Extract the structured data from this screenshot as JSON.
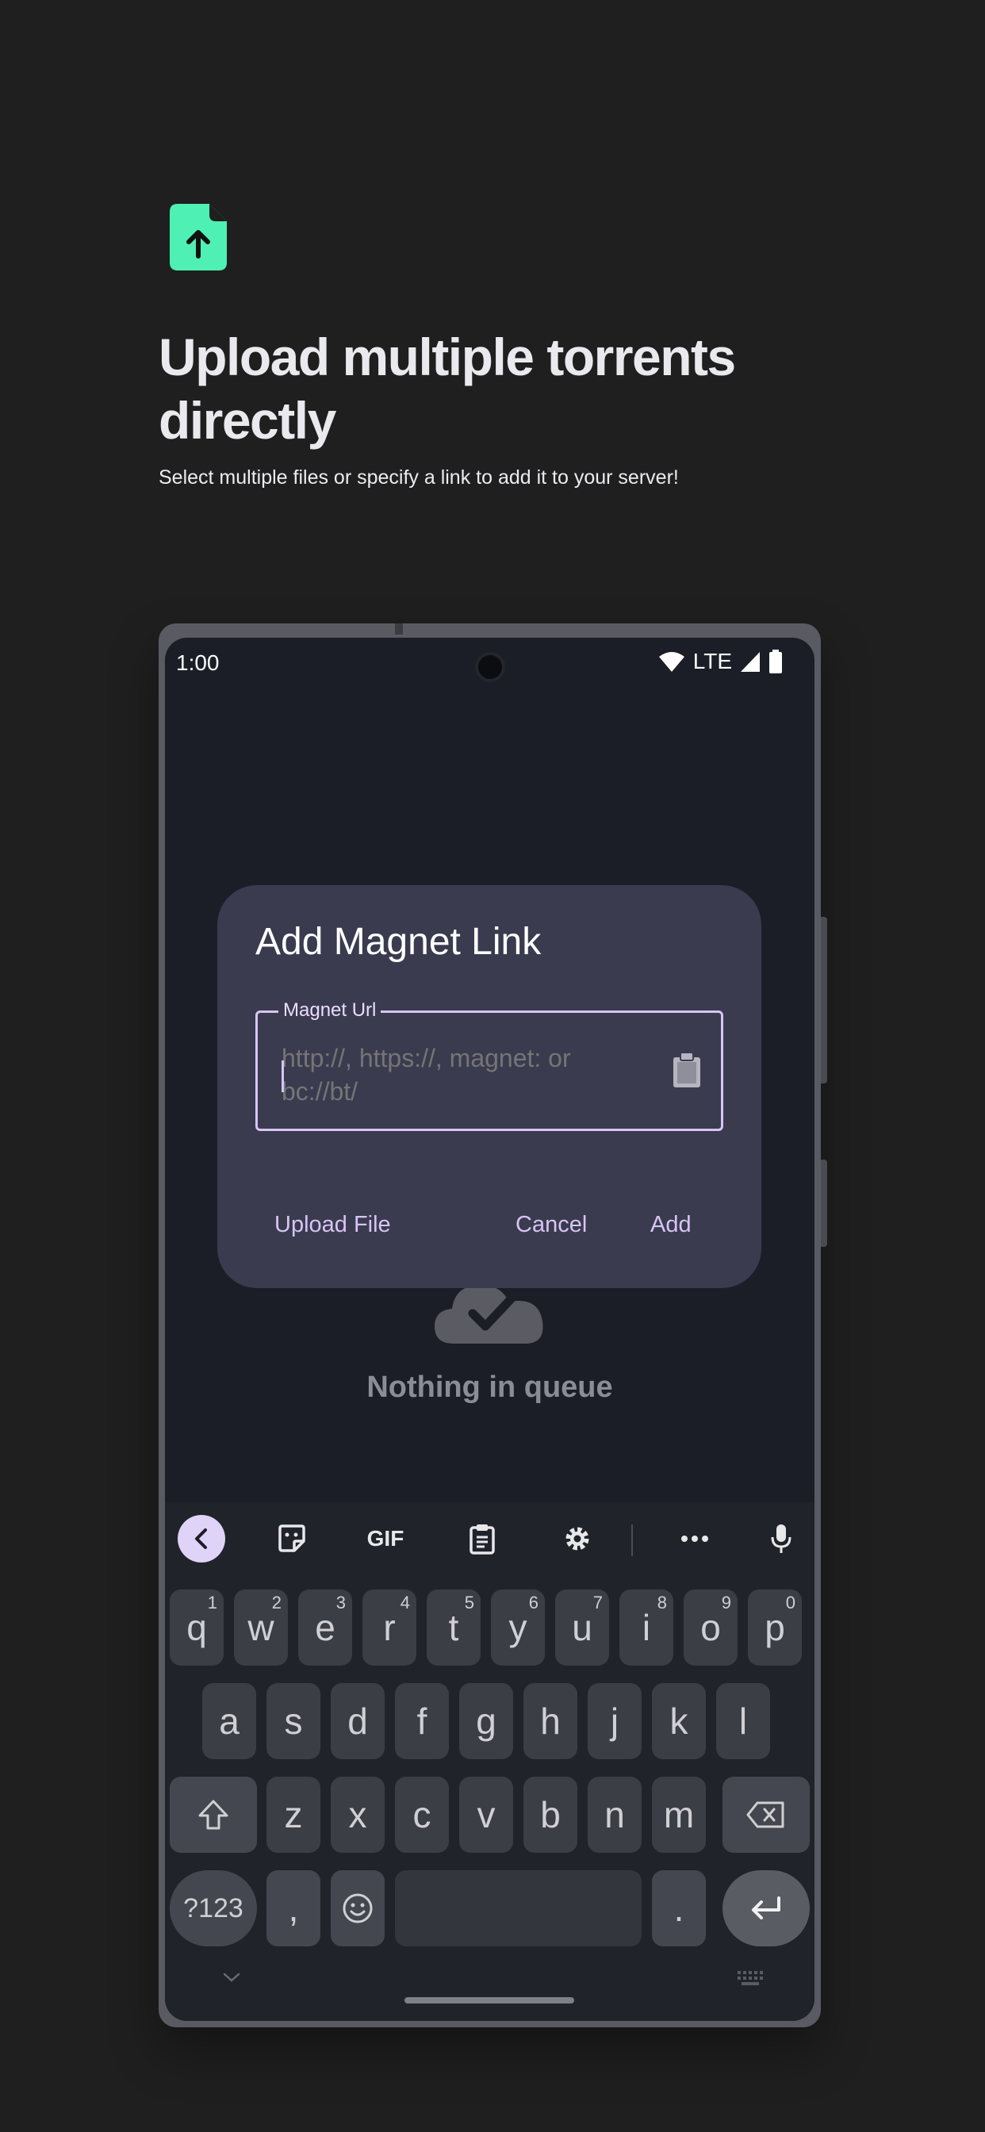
{
  "promo": {
    "title": "Upload multiple torrents directly",
    "subtitle": "Select multiple files or specify a link to add it to your server!",
    "icon": "file-upload-icon",
    "accent_color": "#4ff0b4"
  },
  "statusbar": {
    "time": "1:00",
    "network": "LTE",
    "icons": [
      "wifi-icon",
      "signal-icon",
      "battery-icon"
    ]
  },
  "dialog": {
    "title": "Add Magnet Link",
    "field_label": "Magnet Url",
    "field_placeholder": "http://, https://, magnet: or bc://bt/",
    "paste_icon": "clipboard-icon",
    "upload_label": "Upload File",
    "cancel_label": "Cancel",
    "add_label": "Add",
    "accent_color": "#d8c4f3"
  },
  "empty_state": {
    "text": "Nothing in queue",
    "icon": "cloud-check-icon"
  },
  "keyboard": {
    "toolbar": {
      "gif_label": "GIF",
      "icons": [
        "chevron-left-icon",
        "sticker-icon",
        "clipboard-icon",
        "gear-icon",
        "more-icon",
        "mic-icon"
      ]
    },
    "row1": [
      {
        "key": "q",
        "hint": "1"
      },
      {
        "key": "w",
        "hint": "2"
      },
      {
        "key": "e",
        "hint": "3"
      },
      {
        "key": "r",
        "hint": "4"
      },
      {
        "key": "t",
        "hint": "5"
      },
      {
        "key": "y",
        "hint": "6"
      },
      {
        "key": "u",
        "hint": "7"
      },
      {
        "key": "i",
        "hint": "8"
      },
      {
        "key": "o",
        "hint": "9"
      },
      {
        "key": "p",
        "hint": "0"
      }
    ],
    "row2": [
      "a",
      "s",
      "d",
      "f",
      "g",
      "h",
      "j",
      "k",
      "l"
    ],
    "row3": [
      "z",
      "x",
      "c",
      "v",
      "b",
      "n",
      "m"
    ],
    "symbols_label": "?123",
    "comma": ",",
    "period": "."
  }
}
